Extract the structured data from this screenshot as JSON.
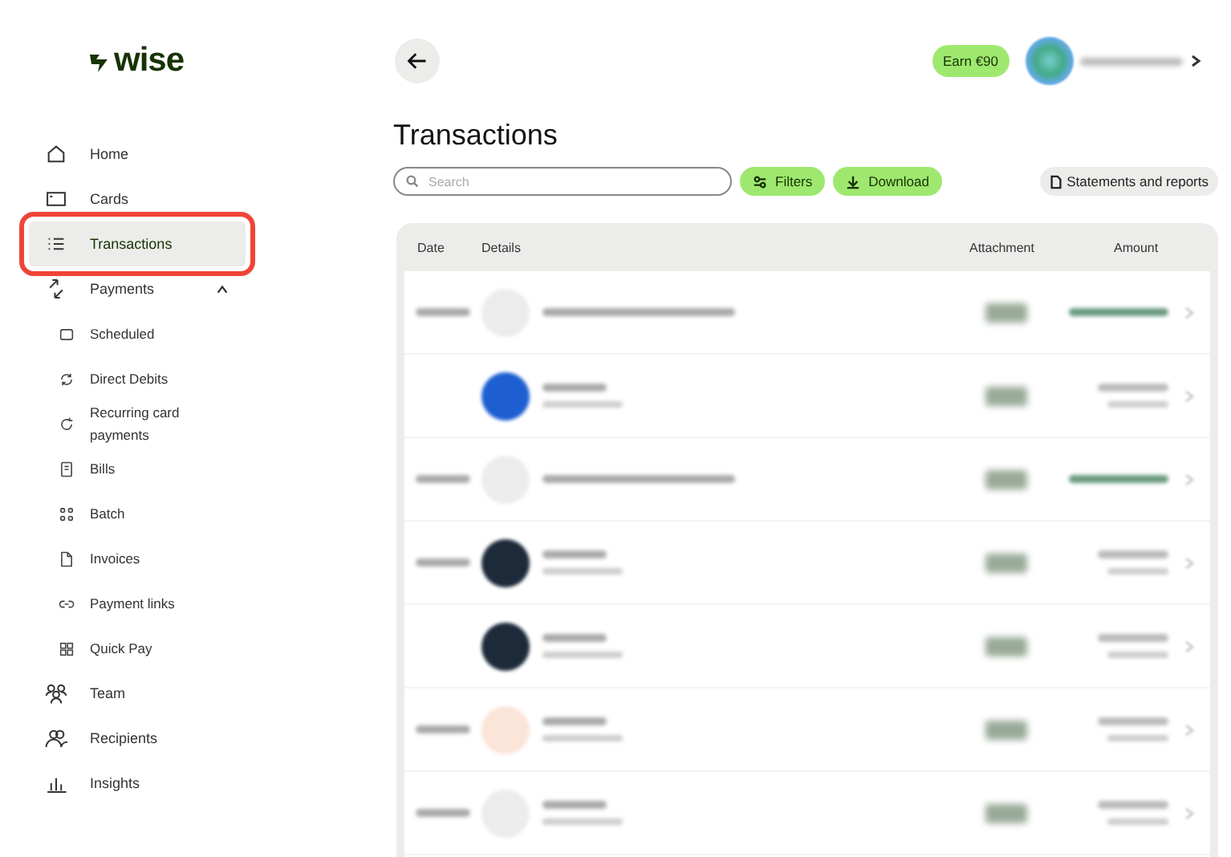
{
  "logo": {
    "text": "wise"
  },
  "sidebar": {
    "items": [
      {
        "label": "Home",
        "selected": false,
        "highlighted": false
      },
      {
        "label": "Cards",
        "selected": false,
        "highlighted": false
      },
      {
        "label": "Transactions",
        "selected": true,
        "highlighted": true
      },
      {
        "label": "Payments",
        "selected": false,
        "highlighted": false,
        "expanded": true,
        "children": [
          {
            "label": "Scheduled",
            "selected": false
          },
          {
            "label": "Direct Debits",
            "selected": false
          },
          {
            "label": "Recurring card payments",
            "selected": false
          },
          {
            "label": "Bills",
            "selected": false
          },
          {
            "label": "Batch",
            "selected": false
          },
          {
            "label": "Invoices",
            "selected": false
          },
          {
            "label": "Payment links",
            "selected": false
          },
          {
            "label": "Quick Pay",
            "selected": false
          }
        ]
      },
      {
        "label": "Team",
        "selected": false,
        "highlighted": false
      },
      {
        "label": "Recipients",
        "selected": false,
        "highlighted": false
      },
      {
        "label": "Insights",
        "selected": false,
        "highlighted": false
      }
    ]
  },
  "header": {
    "earn_button": "Earn €90"
  },
  "page_title": "Transactions",
  "toolbar": {
    "search": {
      "placeholder": "Search"
    },
    "filters_button": "Filters",
    "download_button": "Download",
    "statements_button": "Statements and reports"
  },
  "table": {
    "columns": [
      "Date",
      "Details",
      "Attachment",
      "Amount"
    ],
    "rows": [
      {
        "kind": "grey",
        "has_date": true,
        "subtitle": false,
        "incoming": true
      },
      {
        "kind": "blue",
        "has_date": false,
        "subtitle": true,
        "incoming": false
      },
      {
        "kind": "grey",
        "has_date": true,
        "subtitle": false,
        "incoming": true
      },
      {
        "kind": "dark",
        "has_date": true,
        "subtitle": true,
        "incoming": false
      },
      {
        "kind": "dark",
        "has_date": false,
        "subtitle": true,
        "incoming": false
      },
      {
        "kind": "orange",
        "has_date": true,
        "subtitle": true,
        "incoming": false
      },
      {
        "kind": "grey",
        "has_date": true,
        "subtitle": true,
        "incoming": false
      }
    ]
  }
}
